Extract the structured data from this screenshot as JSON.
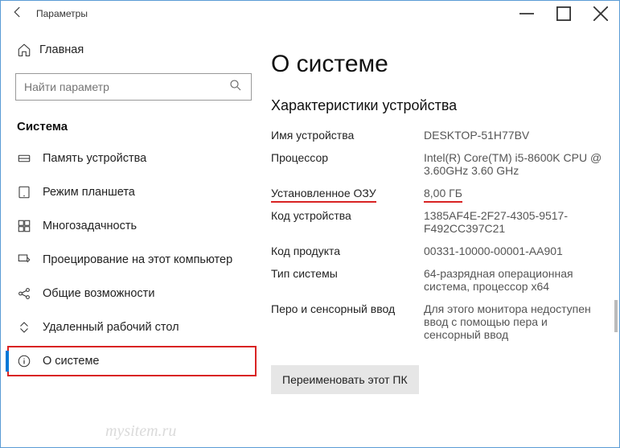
{
  "window": {
    "title": "Параметры"
  },
  "sidebar": {
    "home": "Главная",
    "search_placeholder": "Найти параметр",
    "section": "Система",
    "items": [
      {
        "label": "Память устройства"
      },
      {
        "label": "Режим планшета"
      },
      {
        "label": "Многозадачность"
      },
      {
        "label": "Проецирование на этот компьютер"
      },
      {
        "label": "Общие возможности"
      },
      {
        "label": "Удаленный рабочий стол"
      },
      {
        "label": "О системе"
      }
    ]
  },
  "main": {
    "heading": "О системе",
    "subheading": "Характеристики устройства",
    "specs": {
      "device_name_k": "Имя устройства",
      "device_name_v": "DESKTOP-51H77BV",
      "processor_k": "Процессор",
      "processor_v": "Intel(R) Core(TM) i5-8600K CPU @ 3.60GHz   3.60 GHz",
      "ram_k": "Установленное ОЗУ",
      "ram_v": "8,00 ГБ",
      "device_id_k": "Код устройства",
      "device_id_v": "1385AF4E-2F27-4305-9517-F492CC397C21",
      "product_id_k": "Код продукта",
      "product_id_v": "00331-10000-00001-AA901",
      "system_type_k": "Тип системы",
      "system_type_v": "64-разрядная операционная система, процессор x64",
      "pen_k": "Перо и сенсорный ввод",
      "pen_v": "Для этого монитора недоступен ввод с помощью пера и сенсорный ввод"
    },
    "rename_btn": "Переименовать этот ПК"
  },
  "watermark": "mysitem.ru"
}
